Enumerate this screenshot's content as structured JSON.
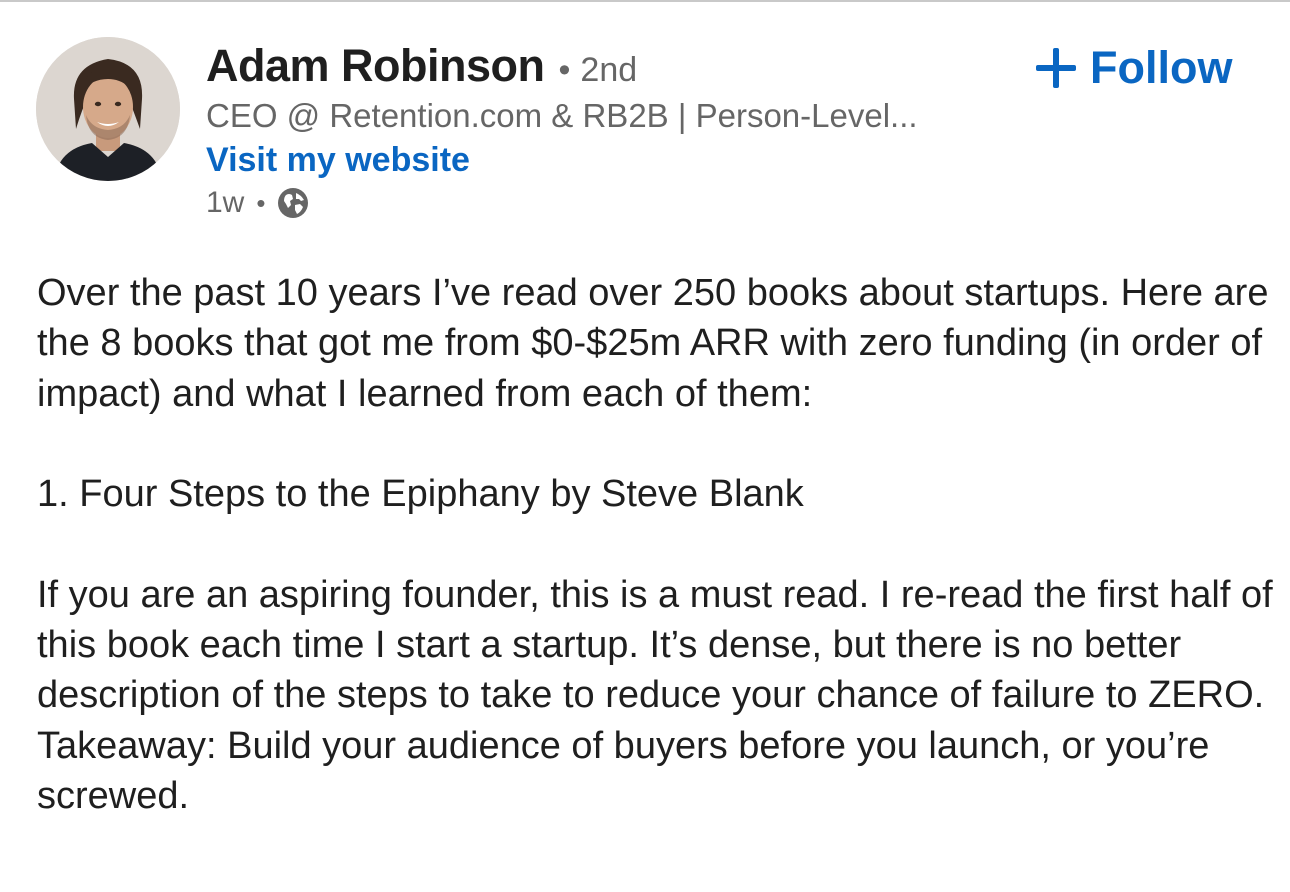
{
  "author": {
    "name": "Adam Robinson",
    "degree": "2nd",
    "headline": "CEO @ Retention.com & RB2B | Person-Level...",
    "website_label": "Visit my website",
    "posted": "1w",
    "visibility_icon": "globe-icon"
  },
  "follow": {
    "label": "Follow",
    "icon": "plus-icon"
  },
  "post": {
    "intro": "Over the past 10 years I’ve read over 250 books about startups. Here are the 8 books that got me from $0-$25m ARR with zero funding (in order of impact) and what I learned from each of them:",
    "item_1_title": "1. Four Steps to the Epiphany by Steve Blank",
    "item_1_body": "If you are an aspiring founder, this is a must read. I re-read the first half of this book each time I start a startup. It’s dense, but there is no better description of the steps to take to reduce your chance of failure to ZERO. Takeaway: Build your audience of buyers before you launch, or you’re screwed."
  },
  "colors": {
    "link_blue": "#0a66c2",
    "secondary_text": "#666666",
    "primary_text": "#1f1f1f"
  }
}
